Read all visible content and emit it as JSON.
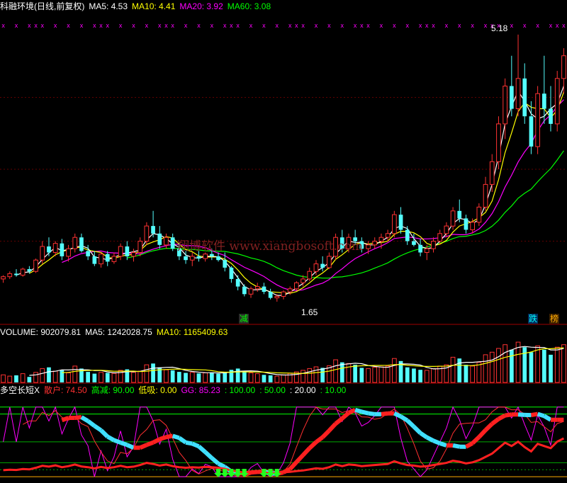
{
  "header": {
    "title": "科融环境(日线,前复权)",
    "ma": [
      {
        "label": "MA5: ",
        "value": "4.53",
        "color": "#ffffff"
      },
      {
        "label": "MA10: ",
        "value": "4.41",
        "color": "#ffff00"
      },
      {
        "label": "MA20: ",
        "value": "3.92",
        "color": "#ff00ff"
      },
      {
        "label": "MA60: ",
        "value": "3.08",
        "color": "#00ff00"
      }
    ]
  },
  "price_panel": {
    "high_label": "5.18",
    "low_label": "1.65",
    "badges": [
      {
        "text": "减",
        "color": "#00ff00",
        "bg": "#2a2a2a"
      },
      {
        "text": "跌",
        "color": "#00ffff",
        "bg": "#003060"
      },
      {
        "text": "榜",
        "color": "#ffaa00",
        "bg": "#3a2000"
      }
    ],
    "watermark": "翔博软件 www.xiangbosoft.com"
  },
  "volume_panel": {
    "items": [
      {
        "label": "VOLUME: ",
        "value": "902079.81",
        "color": "#ffffff"
      },
      {
        "label": "MA5: ",
        "value": "1242028.75",
        "color": "#ffffff"
      },
      {
        "label": "MA10: ",
        "value": "1165409.63",
        "color": "#ffff00"
      }
    ]
  },
  "indicator_panel": {
    "name": "多空长短X",
    "items": [
      {
        "label": "散户: ",
        "value": "74.50",
        "color": "#ff3030"
      },
      {
        "label": "高减: ",
        "value": "90.00",
        "color": "#00ff00"
      },
      {
        "label": "低吸: ",
        "value": "0.00",
        "color": "#ffff00"
      },
      {
        "label": "GG: ",
        "value": "85.23",
        "color": "#ff00ff"
      },
      {
        "label": ": ",
        "value": "100.00",
        "color": "#00ff00"
      },
      {
        "label": ": ",
        "value": "50.00",
        "color": "#00ff00"
      },
      {
        "label": ": ",
        "value": "20.00",
        "color": "#ffffff"
      },
      {
        "label": ": ",
        "value": "10.00",
        "color": "#00ff00"
      }
    ]
  },
  "chart_data": {
    "type": "candlestick",
    "colors": {
      "up": "#ff3232",
      "down": "#54ffff",
      "ma5": "#ffffff",
      "ma10": "#ffff00",
      "ma20": "#ff00ff",
      "ma60": "#00ff00"
    },
    "price_ylim": [
      1.5,
      5.3
    ],
    "marker_rows": [
      "x"
    ],
    "ohlc": [
      [
        1.95,
        2.0,
        1.9,
        1.98
      ],
      [
        1.98,
        2.05,
        1.95,
        2.02
      ],
      [
        2.02,
        2.08,
        1.98,
        2.0
      ],
      [
        2.0,
        2.1,
        1.98,
        2.08
      ],
      [
        2.08,
        2.12,
        2.02,
        2.05
      ],
      [
        2.05,
        2.22,
        2.03,
        2.2
      ],
      [
        2.2,
        2.45,
        2.15,
        2.38
      ],
      [
        2.38,
        2.5,
        2.25,
        2.3
      ],
      [
        2.3,
        2.45,
        2.25,
        2.42
      ],
      [
        2.42,
        2.48,
        2.2,
        2.25
      ],
      [
        2.25,
        2.4,
        2.18,
        2.35
      ],
      [
        2.35,
        2.55,
        2.3,
        2.5
      ],
      [
        2.5,
        2.55,
        2.3,
        2.32
      ],
      [
        2.32,
        2.4,
        2.2,
        2.25
      ],
      [
        2.25,
        2.32,
        2.12,
        2.15
      ],
      [
        2.15,
        2.3,
        2.1,
        2.28
      ],
      [
        2.28,
        2.32,
        2.12,
        2.18
      ],
      [
        2.18,
        2.3,
        2.15,
        2.25
      ],
      [
        2.25,
        2.42,
        2.2,
        2.38
      ],
      [
        2.38,
        2.45,
        2.2,
        2.25
      ],
      [
        2.25,
        2.35,
        2.18,
        2.3
      ],
      [
        2.3,
        2.5,
        2.25,
        2.45
      ],
      [
        2.45,
        2.7,
        2.4,
        2.65
      ],
      [
        2.65,
        2.85,
        2.5,
        2.55
      ],
      [
        2.55,
        2.65,
        2.35,
        2.4
      ],
      [
        2.4,
        2.55,
        2.35,
        2.5
      ],
      [
        2.5,
        2.55,
        2.32,
        2.35
      ],
      [
        2.35,
        2.42,
        2.2,
        2.25
      ],
      [
        2.25,
        2.32,
        2.15,
        2.2
      ],
      [
        2.2,
        2.3,
        2.12,
        2.25
      ],
      [
        2.25,
        2.32,
        2.18,
        2.22
      ],
      [
        2.22,
        2.3,
        2.18,
        2.28
      ],
      [
        2.28,
        2.35,
        2.2,
        2.25
      ],
      [
        2.25,
        2.3,
        2.18,
        2.2
      ],
      [
        2.2,
        2.3,
        2.05,
        2.1
      ],
      [
        2.1,
        2.12,
        1.9,
        1.95
      ],
      [
        1.95,
        2.0,
        1.8,
        1.85
      ],
      [
        1.85,
        1.88,
        1.72,
        1.75
      ],
      [
        1.75,
        1.85,
        1.7,
        1.82
      ],
      [
        1.82,
        1.9,
        1.78,
        1.85
      ],
      [
        1.85,
        1.9,
        1.75,
        1.78
      ],
      [
        1.78,
        1.82,
        1.68,
        1.7
      ],
      [
        1.7,
        1.75,
        1.65,
        1.72
      ],
      [
        1.72,
        1.8,
        1.68,
        1.78
      ],
      [
        1.78,
        1.85,
        1.74,
        1.82
      ],
      [
        1.82,
        1.92,
        1.8,
        1.9
      ],
      [
        1.9,
        2.0,
        1.85,
        1.95
      ],
      [
        1.95,
        2.1,
        1.92,
        2.05
      ],
      [
        2.05,
        2.2,
        2.0,
        2.15
      ],
      [
        2.15,
        2.25,
        2.05,
        2.1
      ],
      [
        2.1,
        2.3,
        2.08,
        2.25
      ],
      [
        2.25,
        2.55,
        2.2,
        2.5
      ],
      [
        2.5,
        2.6,
        2.3,
        2.35
      ],
      [
        2.35,
        2.55,
        2.3,
        2.5
      ],
      [
        2.5,
        2.6,
        2.4,
        2.45
      ],
      [
        2.45,
        2.5,
        2.3,
        2.35
      ],
      [
        2.35,
        2.45,
        2.28,
        2.4
      ],
      [
        2.4,
        2.5,
        2.35,
        2.45
      ],
      [
        2.45,
        2.55,
        2.35,
        2.5
      ],
      [
        2.5,
        2.6,
        2.45,
        2.55
      ],
      [
        2.55,
        2.85,
        2.5,
        2.8
      ],
      [
        2.8,
        2.9,
        2.55,
        2.6
      ],
      [
        2.6,
        2.65,
        2.4,
        2.45
      ],
      [
        2.45,
        2.55,
        2.38,
        2.4
      ],
      [
        2.4,
        2.48,
        2.25,
        2.3
      ],
      [
        2.3,
        2.4,
        2.2,
        2.35
      ],
      [
        2.35,
        2.5,
        2.3,
        2.45
      ],
      [
        2.45,
        2.6,
        2.4,
        2.55
      ],
      [
        2.55,
        2.7,
        2.5,
        2.65
      ],
      [
        2.65,
        2.9,
        2.6,
        2.85
      ],
      [
        2.85,
        3.0,
        2.7,
        2.75
      ],
      [
        2.75,
        2.8,
        2.55,
        2.6
      ],
      [
        2.6,
        2.75,
        2.55,
        2.7
      ],
      [
        2.7,
        2.95,
        2.65,
        2.9
      ],
      [
        2.9,
        3.3,
        2.85,
        3.2
      ],
      [
        3.2,
        3.6,
        3.1,
        3.5
      ],
      [
        3.5,
        4.1,
        3.4,
        4.0
      ],
      [
        4.0,
        4.6,
        3.8,
        4.5
      ],
      [
        4.5,
        4.9,
        4.1,
        4.2
      ],
      [
        4.2,
        5.18,
        4.1,
        4.6
      ],
      [
        4.6,
        4.8,
        4.0,
        4.1
      ],
      [
        4.1,
        4.3,
        3.6,
        3.7
      ],
      [
        3.7,
        4.5,
        3.6,
        4.4
      ],
      [
        4.4,
        4.9,
        4.0,
        4.2
      ],
      [
        4.2,
        4.5,
        3.9,
        4.0
      ],
      [
        4.0,
        4.7,
        3.9,
        4.6
      ],
      [
        4.6,
        5.0,
        4.4,
        4.9
      ]
    ],
    "volume": [
      30,
      25,
      28,
      35,
      22,
      40,
      55,
      60,
      45,
      50,
      38,
      65,
      55,
      42,
      35,
      40,
      38,
      36,
      48,
      52,
      40,
      45,
      70,
      75,
      60,
      50,
      48,
      42,
      38,
      40,
      36,
      38,
      40,
      35,
      42,
      50,
      55,
      45,
      38,
      35,
      30,
      28,
      25,
      30,
      36,
      42,
      48,
      55,
      62,
      58,
      66,
      90,
      80,
      75,
      70,
      58,
      55,
      60,
      62,
      65,
      95,
      85,
      60,
      55,
      50,
      48,
      55,
      65,
      70,
      100,
      95,
      70,
      65,
      80,
      110,
      120,
      135,
      150,
      130,
      160,
      140,
      120,
      145,
      130,
      110,
      140,
      150
    ],
    "volume_ylim": [
      0,
      180
    ],
    "indicator_ylim": [
      -5,
      115
    ],
    "indicator_hlines": [
      100,
      90,
      50,
      20,
      10,
      0
    ]
  }
}
